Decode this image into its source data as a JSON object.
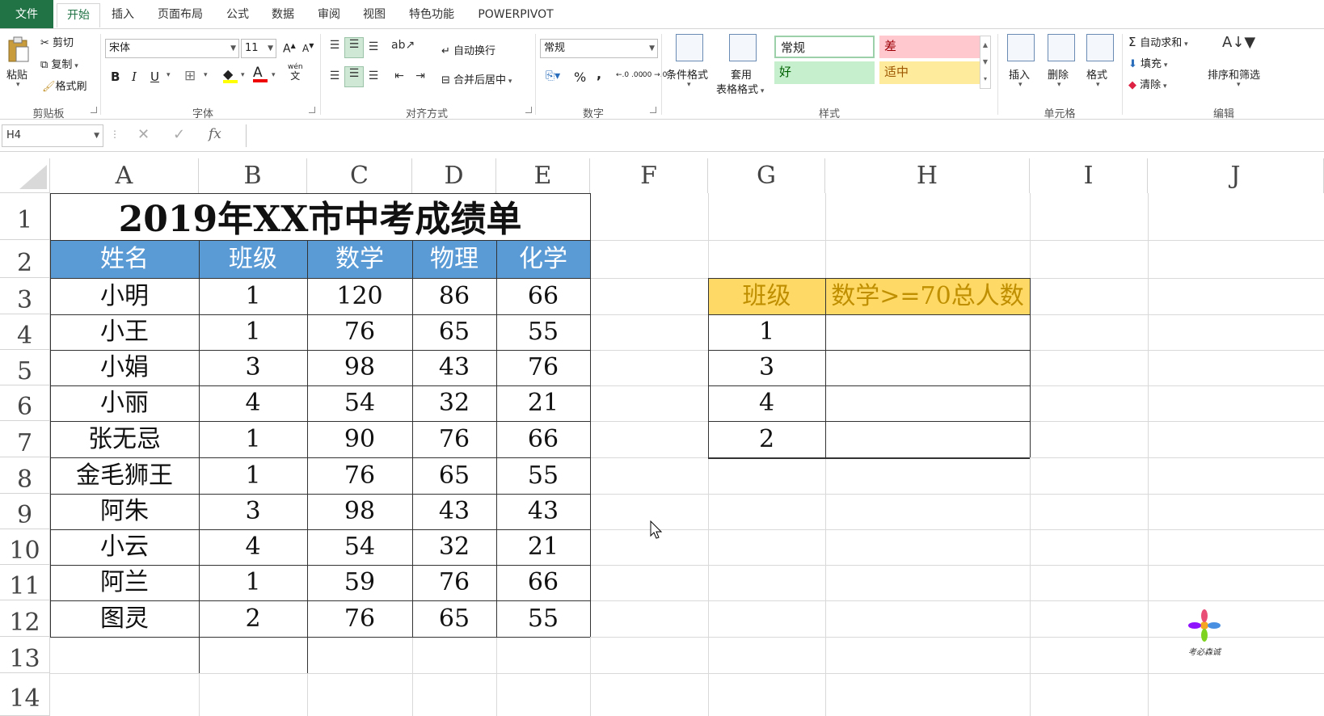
{
  "ribbon_tabs": [
    "文件",
    "开始",
    "插入",
    "页面布局",
    "公式",
    "数据",
    "审阅",
    "视图",
    "特色功能",
    "POWERPIVOT"
  ],
  "clipboard": {
    "paste": "粘贴",
    "cut": "剪切",
    "copy": "复制",
    "format_painter": "格式刷",
    "group": "剪贴板"
  },
  "font": {
    "name": "宋体",
    "size": "11",
    "bold": "B",
    "italic": "I",
    "underline": "U",
    "group": "字体",
    "grow": "A",
    "shrink": "A",
    "wen": "wén",
    "wen2": "文"
  },
  "alignment": {
    "wrap": "自动换行",
    "merge": "合并后居中",
    "group": "对齐方式"
  },
  "number": {
    "format": "常规",
    "percent": "%",
    "comma": ",",
    "inc_decimal": "←.0 .00",
    "dec_decimal": ".00 →.0",
    "group": "数字"
  },
  "styles": {
    "conditional": "条件格式",
    "table_format_1": "套用",
    "table_format_2": "表格格式",
    "normal": "常规",
    "bad": "差",
    "good": "好",
    "neutral": "适中",
    "group": "样式"
  },
  "cells": {
    "insert": "插入",
    "delete": "删除",
    "format": "格式",
    "group": "单元格"
  },
  "editing": {
    "autosum": "自动求和",
    "fill": "填充",
    "clear": "清除",
    "sort_filter": "排序和筛选",
    "group": "编辑"
  },
  "formula_bar": {
    "name_box": "H4",
    "fx": "fx",
    "formula": ""
  },
  "columns": [
    "A",
    "B",
    "C",
    "D",
    "E",
    "F",
    "G",
    "H",
    "I",
    "J"
  ],
  "rows": [
    "1",
    "2",
    "3",
    "4",
    "5",
    "6",
    "7",
    "8",
    "9",
    "10",
    "11",
    "12",
    "13",
    "14"
  ],
  "sheet": {
    "title": "2019年XX市中考成绩单",
    "headers": [
      "姓名",
      "班级",
      "数学",
      "物理",
      "化学"
    ],
    "records": [
      [
        "小明",
        "1",
        "120",
        "86",
        "66"
      ],
      [
        "小王",
        "1",
        "76",
        "65",
        "55"
      ],
      [
        "小娟",
        "3",
        "98",
        "43",
        "76"
      ],
      [
        "小丽",
        "4",
        "54",
        "32",
        "21"
      ],
      [
        "张无忌",
        "1",
        "90",
        "76",
        "66"
      ],
      [
        "金毛狮王",
        "1",
        "76",
        "65",
        "55"
      ],
      [
        "阿朱",
        "3",
        "98",
        "43",
        "43"
      ],
      [
        "小云",
        "4",
        "54",
        "32",
        "21"
      ],
      [
        "阿兰",
        "1",
        "59",
        "76",
        "66"
      ],
      [
        "图灵",
        "2",
        "76",
        "65",
        "55"
      ]
    ],
    "summary_headers": [
      "班级",
      "数学>=70总人数"
    ],
    "summary_rows": [
      [
        "1",
        ""
      ],
      [
        "3",
        ""
      ],
      [
        "4",
        ""
      ],
      [
        "2",
        ""
      ]
    ]
  },
  "watermark": "考必森诚",
  "colors": {
    "excel_green": "#217346",
    "header_blue": "#5b9bd5",
    "summary_yellow": "#ffd966",
    "summary_text": "#bf8f00"
  }
}
